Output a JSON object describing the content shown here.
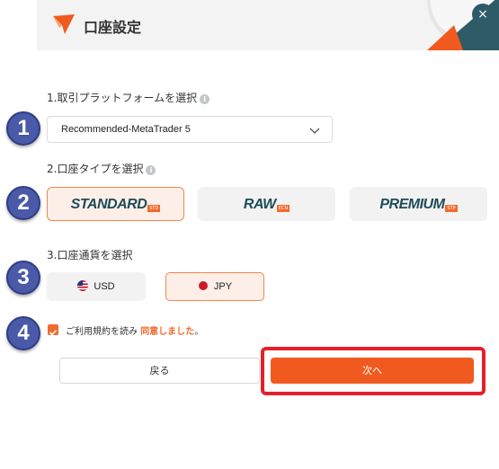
{
  "header": {
    "title": "口座設定",
    "close_glyph": "×"
  },
  "sections": {
    "platform": {
      "label": "1.取引プラットフォームを選択",
      "info": "i"
    },
    "account_type": {
      "label": "2.口座タイプを選択",
      "info": "i"
    },
    "currency": {
      "label": "3.口座通貨を選択"
    }
  },
  "steps": [
    "1",
    "2",
    "3",
    "4"
  ],
  "platform_select": {
    "value": "Recommended-MetaTrader 5"
  },
  "account_types": [
    {
      "name": "STANDARD",
      "tag": "STD",
      "selected": true
    },
    {
      "name": "RAW",
      "tag": "ECN",
      "selected": false
    },
    {
      "name": "PREMIUM",
      "tag": "STP",
      "selected": false
    }
  ],
  "currencies": [
    {
      "code": "USD",
      "flag_icon": "us-flag-icon",
      "selected": false
    },
    {
      "code": "JPY",
      "flag_icon": "jp-flag-icon",
      "selected": true
    }
  ],
  "terms": {
    "checked": true,
    "prefix": "ご利用規約を読み ",
    "agree": "同意しました",
    "suffix": "。"
  },
  "buttons": {
    "back": "戻る",
    "next": "次へ"
  },
  "colors": {
    "accent": "#f15a1f",
    "brand_dark": "#1e4b58",
    "highlight": "#e5202a",
    "step_badge": "#4a5aa8"
  }
}
